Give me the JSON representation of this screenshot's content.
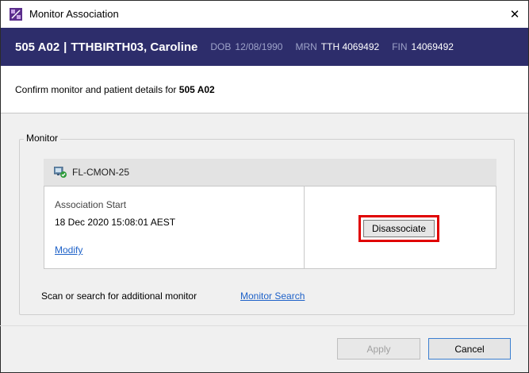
{
  "window": {
    "title": "Monitor Association",
    "close_glyph": "✕"
  },
  "patient": {
    "room": "505 A02",
    "separator": "|",
    "name": "TTHBIRTH03, Caroline",
    "dob_label": "DOB",
    "dob": "12/08/1990",
    "mrn_label": "MRN",
    "mrn": "TTH 4069492",
    "fin_label": "FIN",
    "fin": "14069492"
  },
  "confirm": {
    "prefix": "Confirm monitor and patient details for",
    "room": "505 A02"
  },
  "monitor_group": {
    "legend": "Monitor",
    "monitor_name": "FL-CMON-25",
    "association_label": "Association Start",
    "association_time": "18 Dec 2020 15:08:01 AEST",
    "modify_link": "Modify",
    "disassociate_button": "Disassociate"
  },
  "scan": {
    "text": "Scan or search for additional monitor",
    "search_link": "Monitor Search"
  },
  "footer": {
    "apply_button": "Apply",
    "cancel_button": "Cancel"
  },
  "icons": {
    "app": "app-logo-icon",
    "monitor": "monitor-check-icon",
    "close": "close-icon"
  },
  "colors": {
    "banner": "#2d2d6b",
    "banner_label": "#9ea3c9",
    "link": "#1d61c8",
    "highlight": "#e00000",
    "cancel_border": "#3c7fd1"
  }
}
